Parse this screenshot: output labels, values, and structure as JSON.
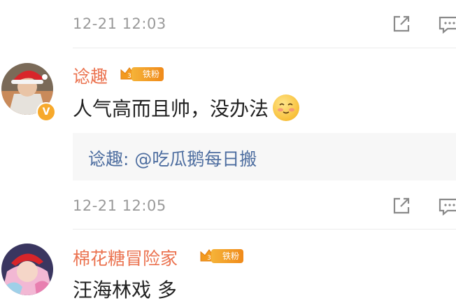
{
  "comments": [
    {
      "time": "12-21 12:03"
    },
    {
      "username": "谂趣",
      "fan_badge": "铁粉",
      "fan_level": "3",
      "text": "人气高而且帅，没办法",
      "quote": "谂趣: @吃瓜鹅每日搬",
      "time": "12-21 12:05"
    },
    {
      "username": "棉花糖冒险家",
      "fan_badge": "铁粉",
      "fan_level": "3",
      "text": "汪海林戏 多"
    }
  ],
  "icons": {
    "share": "share-icon",
    "comment": "comment-icon",
    "verified": "verified-badge-icon",
    "emoji": "blush-emoji-icon"
  },
  "colors": {
    "username": "#eb7350",
    "quote_text": "#4e6ea0",
    "badge": "#f08a1a",
    "meta": "#9a9a9a"
  }
}
